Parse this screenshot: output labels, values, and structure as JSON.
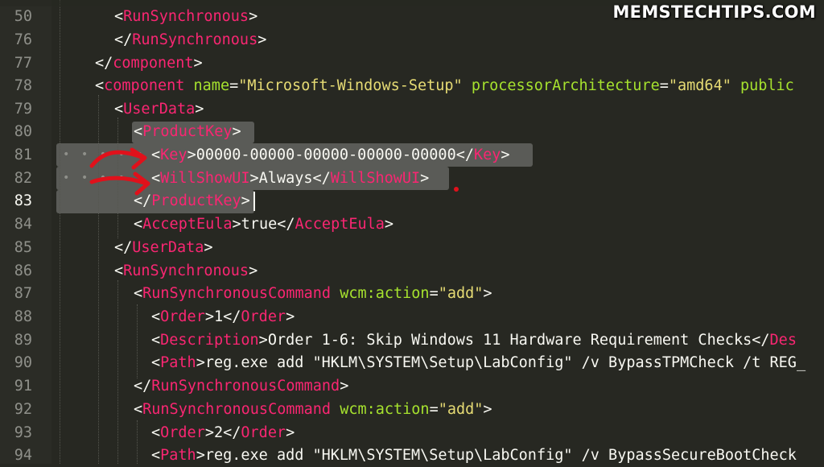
{
  "watermark": "MEMSTECHTIPS.COM",
  "colors": {
    "background": "#272822",
    "tag": "#f92672",
    "attribute": "#a6e22e",
    "string": "#e6db74",
    "text": "#f8f8f2",
    "line_number": "#8f908a",
    "selection": "#5a5b57",
    "annotation": "#e0111b"
  },
  "annotations": [
    "red-arrow-icon",
    "red-arrow-icon",
    "red-dot"
  ],
  "editor": {
    "current_line": "83",
    "lines": [
      {
        "num": "50",
        "text": "<RunSynchronous>"
      },
      {
        "num": "76",
        "text": "</RunSynchronous>"
      },
      {
        "num": "77",
        "text": "</component>"
      },
      {
        "num": "78",
        "text": "<component name=\"Microsoft-Windows-Setup\" processorArchitecture=\"amd64\" public"
      },
      {
        "num": "79",
        "text": "<UserData>"
      },
      {
        "num": "80",
        "text": "<ProductKey>"
      },
      {
        "num": "81",
        "text": "<Key>00000-00000-00000-00000-00000</Key>"
      },
      {
        "num": "82",
        "text": "<WillShowUI>Always</WillShowUI>"
      },
      {
        "num": "83",
        "text": "</ProductKey>"
      },
      {
        "num": "84",
        "text": "<AcceptEula>true</AcceptEula>"
      },
      {
        "num": "85",
        "text": "</UserData>"
      },
      {
        "num": "86",
        "text": "<RunSynchronous>"
      },
      {
        "num": "87",
        "text": "<RunSynchronousCommand wcm:action=\"add\">"
      },
      {
        "num": "88",
        "text": "<Order>1</Order>"
      },
      {
        "num": "89",
        "text": "<Description>Order 1-6: Skip Windows 11 Hardware Requirement Checks</Des"
      },
      {
        "num": "90",
        "text": "<Path>reg.exe add \"HKLM\\SYSTEM\\Setup\\LabConfig\" /v BypassTPMCheck /t REG_"
      },
      {
        "num": "91",
        "text": "</RunSynchronousCommand>"
      },
      {
        "num": "92",
        "text": "<RunSynchronousCommand wcm:action=\"add\">"
      },
      {
        "num": "93",
        "text": "<Order>2</Order>"
      },
      {
        "num": "94",
        "text": "<Path>reg.exe add \"HKLM\\SYSTEM\\Setup\\LabConfig\" /v BypassSecureBootCheck"
      }
    ]
  }
}
